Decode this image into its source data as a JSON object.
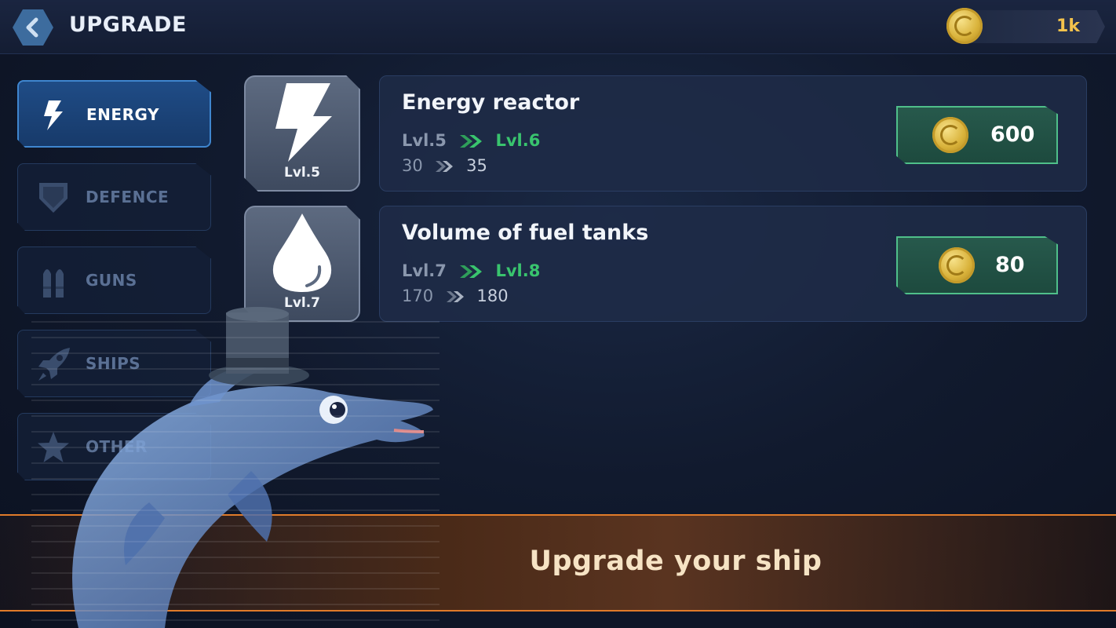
{
  "header": {
    "title": "UPGRADE",
    "currency": {
      "icon": "coin-icon",
      "value": "1k",
      "color": "#f3c24c"
    }
  },
  "sidebar": {
    "items": [
      {
        "label": "ENERGY",
        "icon": "lightning-icon",
        "active": true
      },
      {
        "label": "DEFENCE",
        "icon": "shield-icon",
        "active": false
      },
      {
        "label": "GUNS",
        "icon": "bullets-icon",
        "active": false
      },
      {
        "label": "SHIPS",
        "icon": "rocket-icon",
        "active": false
      },
      {
        "label": "OTHER",
        "icon": "star-icon",
        "active": false
      }
    ]
  },
  "upgrades": [
    {
      "icon": "lightning-icon",
      "tile_level": "Lvl.5",
      "name": "Energy reactor",
      "level_from": "Lvl.5",
      "level_to": "Lvl.6",
      "value_from": "30",
      "value_to": "35",
      "price": "600"
    },
    {
      "icon": "fuel-drop-icon",
      "tile_level": "Lvl.7",
      "name": "Volume of fuel tanks",
      "level_from": "Lvl.7",
      "level_to": "Lvl.8",
      "value_from": "170",
      "value_to": "180",
      "price": "80"
    }
  ],
  "banner": {
    "text": "Upgrade your ship"
  },
  "colors": {
    "accent_blue": "#3f86cf",
    "next_level_green": "#39c46e",
    "buy_button_border": "#4fbf8a",
    "banner_border": "#e07b2a"
  }
}
